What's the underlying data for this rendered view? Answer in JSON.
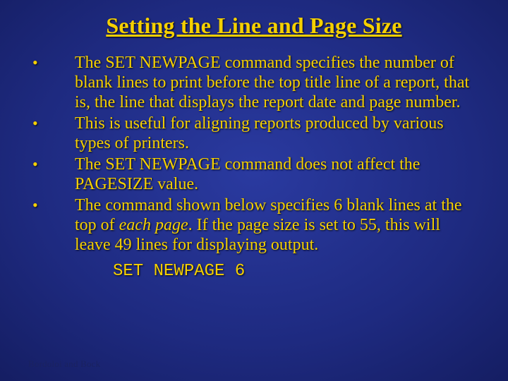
{
  "title": "Setting the Line and Page Size",
  "bullets": [
    {
      "pre": "The SET NEWPAGE command specifies the number of blank lines to print before the top title line of a report, that is, the line that displays the report date and page number.",
      "em": "",
      "post": ""
    },
    {
      "pre": "This is useful for aligning reports produced by various types of printers.",
      "em": "",
      "post": ""
    },
    {
      "pre": "The SET NEWPAGE command does not affect the PAGESIZE value.",
      "em": "",
      "post": ""
    },
    {
      "pre": "The command shown below specifies 6 blank lines at the top of ",
      "em": "each page",
      "post": ".  If the page size is set to 55, this will leave 49 lines for displaying output."
    }
  ],
  "code": "SET NEWPAGE 6",
  "footer": "Bordoloi and Bock",
  "dot": "•"
}
